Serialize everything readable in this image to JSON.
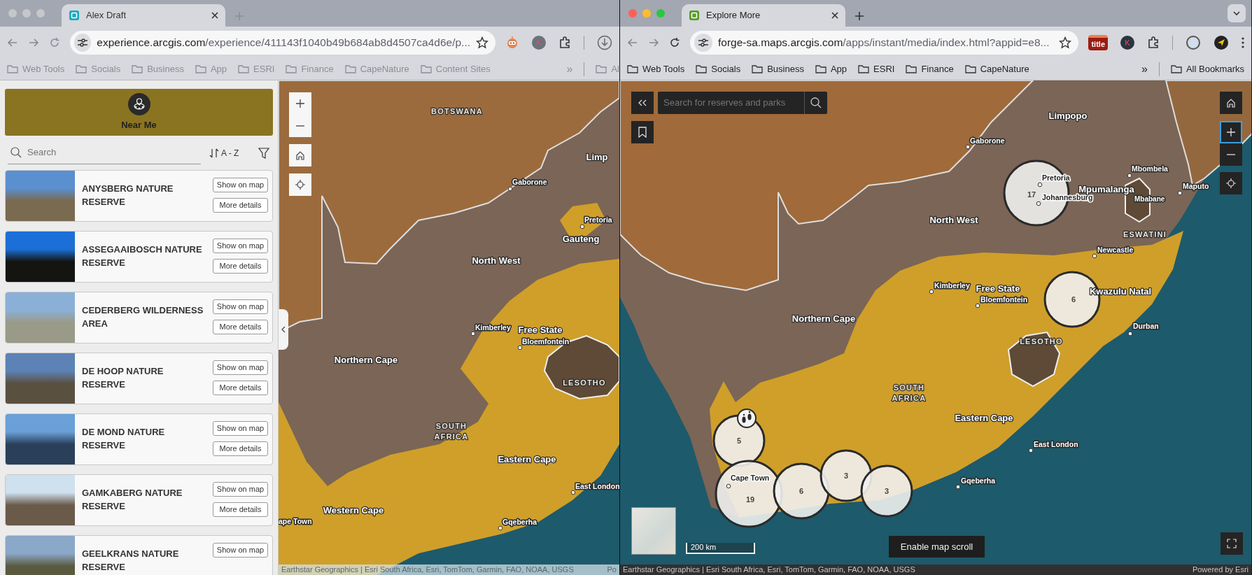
{
  "windows": [
    {
      "kind": "experience",
      "active": false,
      "tab": {
        "title": "Alex Draft"
      },
      "url": {
        "domain": "experience.arcgis.com",
        "path": "/experience/411143f1040b49b684ab8d4507ca4d6e/p..."
      },
      "extensions": [
        {
          "kind": "robot"
        },
        {
          "kind": "avatar",
          "text": "K"
        },
        {
          "kind": "puzzle"
        },
        {
          "kind": "divider"
        },
        {
          "kind": "download"
        }
      ],
      "bookmarks": [
        "Web Tools",
        "Socials",
        "Business",
        "App",
        "ESRI",
        "Finance",
        "CapeNature",
        "Content Sites"
      ],
      "bookmarks_more": "»",
      "all_bookmarks": "Al",
      "app": {
        "near_me": "Near Me",
        "search": {
          "placeholder": "Search"
        },
        "sort": "A - Z",
        "reserves": [
          {
            "name": "ANYSBERG NATURE RESERVE",
            "show_button": "Show on map",
            "details_button": "More details"
          },
          {
            "name": "ASSEGAAIBOSCH NATURE RESERVE",
            "show_button": "Show on map",
            "details_button": "More details"
          },
          {
            "name": "CEDERBERG WILDERNESS AREA",
            "show_button": "Show on map",
            "details_button": "More details"
          },
          {
            "name": "DE HOOP NATURE RESERVE",
            "show_button": "Show on map",
            "details_button": "More details"
          },
          {
            "name": "DE MOND NATURE RESERVE",
            "show_button": "Show on map",
            "details_button": "More details"
          },
          {
            "name": "GAMKABERG NATURE RESERVE",
            "show_button": "Show on map",
            "details_button": "More details"
          },
          {
            "name": "GEELKRANS NATURE RESERVE",
            "show_button": "Show on map"
          }
        ],
        "map": {
          "controls": [
            {
              "kind": "zoom-in"
            },
            {
              "kind": "zoom-out"
            },
            {
              "kind": "home"
            },
            {
              "kind": "locate"
            }
          ],
          "labels": [
            {
              "text": "BOTSWANA",
              "kind": "country"
            },
            {
              "text": "Limp",
              "kind": "province"
            },
            {
              "text": "Gaborone",
              "kind": "city"
            },
            {
              "text": "Pretoria",
              "kind": "city"
            },
            {
              "text": "Gauteng",
              "kind": "province"
            },
            {
              "text": "North West",
              "kind": "province"
            },
            {
              "text": "Kimberley",
              "kind": "city"
            },
            {
              "text": "Free State",
              "kind": "province"
            },
            {
              "text": "Bloemfontein",
              "kind": "city"
            },
            {
              "text": "Northern Cape",
              "kind": "province"
            },
            {
              "text": "LESOTHO",
              "kind": "country"
            },
            {
              "text": "SOUTH AFRICA",
              "kind": "country"
            },
            {
              "text": "Eastern Cape",
              "kind": "province"
            },
            {
              "text": "East London",
              "kind": "city"
            },
            {
              "text": "Western Cape",
              "kind": "province"
            },
            {
              "text": "ape Town",
              "kind": "city"
            },
            {
              "text": "Gqeberha",
              "kind": "city"
            }
          ],
          "attribution": "Earthstar Geographics | Esri South Africa, Esri, TomTom, Garmin, FAO, NOAA, USGS",
          "attribution_more": "Po"
        }
      }
    },
    {
      "kind": "instant",
      "active": true,
      "tab": {
        "title": "Explore More"
      },
      "url": {
        "domain": "forge-sa.maps.arcgis.com",
        "path": "/apps/instant/media/index.html?appid=e8..."
      },
      "extensions": [
        {
          "kind": "badge",
          "text": "title"
        },
        {
          "kind": "avatar",
          "text": "K"
        },
        {
          "kind": "puzzle"
        },
        {
          "kind": "divider"
        },
        {
          "kind": "spinner"
        },
        {
          "kind": "navigator"
        },
        {
          "kind": "menu"
        }
      ],
      "bookmarks": [
        "Web Tools",
        "Socials",
        "Business",
        "App",
        "ESRI",
        "Finance",
        "CapeNature"
      ],
      "bookmarks_more": "»",
      "all_bookmarks": "All Bookmarks",
      "app": {
        "map": {
          "search": {
            "placeholder": "Search for reserves and parks"
          },
          "controls": [
            {
              "kind": "home",
              "focused": false
            },
            {
              "kind": "zoom-in",
              "focused": true
            },
            {
              "kind": "zoom-out",
              "focused": false
            },
            {
              "kind": "locate",
              "focused": false
            }
          ],
          "clusters": [
            {
              "count": "17"
            },
            {
              "count": "6"
            },
            {
              "count": "5"
            },
            {
              "count": "19"
            },
            {
              "count": "6"
            },
            {
              "count": "3"
            },
            {
              "count": "3"
            }
          ],
          "labels": [
            {
              "text": "Limpopo",
              "kind": "province"
            },
            {
              "text": "Gaborone",
              "kind": "city"
            },
            {
              "text": "Mbombela",
              "kind": "city"
            },
            {
              "text": "Pretoria",
              "kind": "city"
            },
            {
              "text": "Johannesburg",
              "kind": "city"
            },
            {
              "text": "Mpumalanga",
              "kind": "province"
            },
            {
              "text": "Maputo",
              "kind": "city"
            },
            {
              "text": "Mbabane",
              "kind": "town"
            },
            {
              "text": "ESWATINI",
              "kind": "country"
            },
            {
              "text": "North West",
              "kind": "province"
            },
            {
              "text": "Newcastle",
              "kind": "city"
            },
            {
              "text": "Kimberley",
              "kind": "city"
            },
            {
              "text": "Free State",
              "kind": "province"
            },
            {
              "text": "Bloemfontein",
              "kind": "city"
            },
            {
              "text": "Kwazulu Natal",
              "kind": "province"
            },
            {
              "text": "Durban",
              "kind": "city"
            },
            {
              "text": "Northern Cape",
              "kind": "province"
            },
            {
              "text": "LESOTHO",
              "kind": "country"
            },
            {
              "text": "SOUTH AFRICA",
              "kind": "country"
            },
            {
              "text": "Eastern Cape",
              "kind": "province"
            },
            {
              "text": "East London",
              "kind": "city"
            },
            {
              "text": "Gqeberha",
              "kind": "city"
            },
            {
              "text": "Cape Town",
              "kind": "city"
            }
          ],
          "scale": "200 km",
          "scroll_button": "Enable map scroll",
          "attribution": "Earthstar Geographics | Esri South Africa, Esri, TomTom, Garmin, FAO, NOAA, USGS",
          "powered_by": "Powered by Esri"
        }
      }
    }
  ]
}
